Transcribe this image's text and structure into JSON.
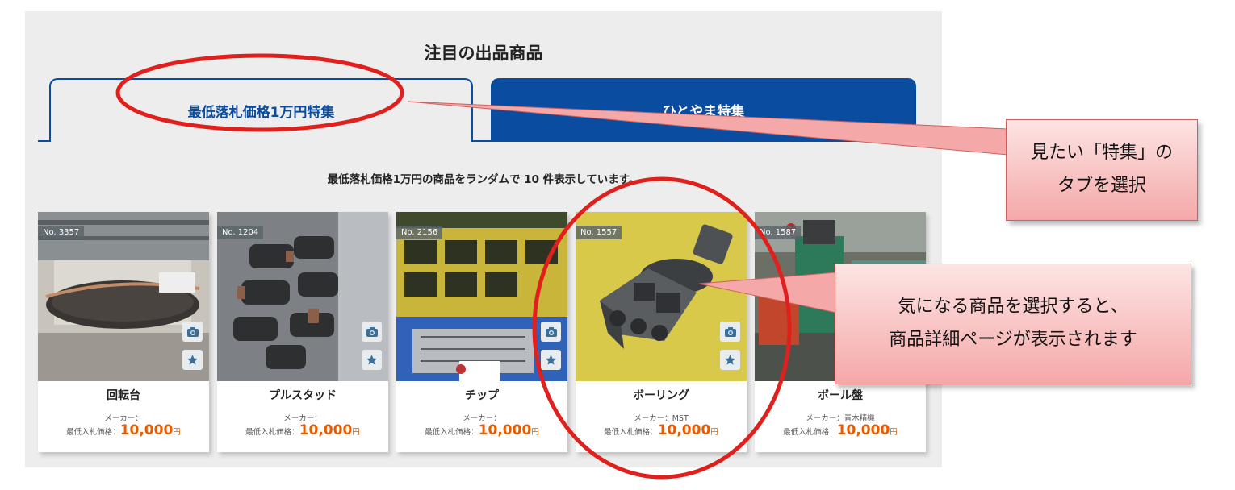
{
  "section": {
    "title": "注目の出品商品",
    "subtitle": "最低落札価格1万円の商品をランダムで 10 件表示しています。"
  },
  "tabs": [
    {
      "label": "最低落札価格1万円特集",
      "active": true
    },
    {
      "label": "ひとやま特集",
      "active": false
    }
  ],
  "products": [
    {
      "no": "No. 3357",
      "name": "回転台",
      "maker": "メーカー：",
      "price_label": "最低入札価格：",
      "price": "10,000",
      "currency": "円"
    },
    {
      "no": "No. 1204",
      "name": "プルスタッド",
      "maker": "メーカー：",
      "price_label": "最低入札価格：",
      "price": "10,000",
      "currency": "円"
    },
    {
      "no": "No. 2156",
      "name": "チップ",
      "maker": "メーカー：",
      "price_label": "最低入札価格：",
      "price": "10,000",
      "currency": "円"
    },
    {
      "no": "No. 1557",
      "name": "ボーリング",
      "maker": "メーカー：MST",
      "price_label": "最低入札価格：",
      "price": "10,000",
      "currency": "円"
    },
    {
      "no": "No. 1587",
      "name": "ボール盤",
      "maker": "メーカー：青木精機",
      "price_label": "最低入札価格：",
      "price": "10,000",
      "currency": "円"
    }
  ],
  "annotations": {
    "tab_callout": {
      "line1": "見たい「特集」の",
      "line2": "タブを選択"
    },
    "product_callout": {
      "line1": "気になる商品を選択すると、",
      "line2": "商品詳細ページが表示されます"
    }
  },
  "icons": {
    "camera": "camera-icon",
    "star": "star-icon"
  },
  "colors": {
    "brand_blue": "#0a4da0",
    "price_orange": "#e65c00",
    "annotation_red": "#e0201c",
    "callout_fill": "#f5a8a8"
  }
}
